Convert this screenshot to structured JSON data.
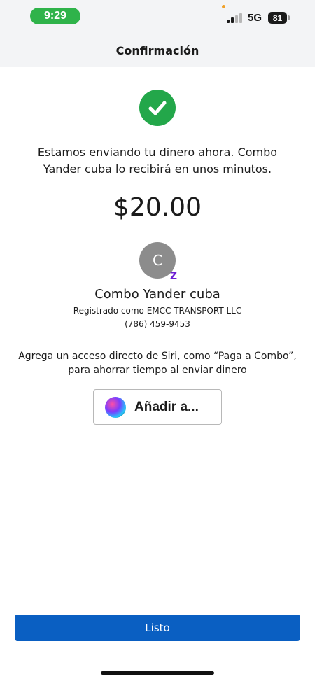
{
  "status_bar": {
    "time": "9:29",
    "network": "5G",
    "battery": "81"
  },
  "header": {
    "title": "Confirmación"
  },
  "confirmation": {
    "message": "Estamos enviando tu dinero ahora. Combo Yander cuba lo recibirá en unos minutos.",
    "amount": "$20.00"
  },
  "recipient": {
    "initial": "C",
    "badge": "Z",
    "name": "Combo Yander cuba",
    "registered_as": "Registrado como EMCC TRANSPORT LLC",
    "phone": "(786) 459-9453"
  },
  "siri": {
    "prompt": "Agrega un acceso directo de Siri, como “Paga a Combo”, para ahorrar tiempo al enviar dinero",
    "button_label": "Añadir a..."
  },
  "actions": {
    "done_label": "Listo"
  },
  "colors": {
    "success": "#23a74a",
    "primary": "#0a5fc2",
    "zelle": "#6d1ed4",
    "time_pill": "#2fb34a"
  },
  "icons": {
    "success": "check-icon",
    "siri": "siri-icon",
    "zelle": "zelle-icon"
  }
}
